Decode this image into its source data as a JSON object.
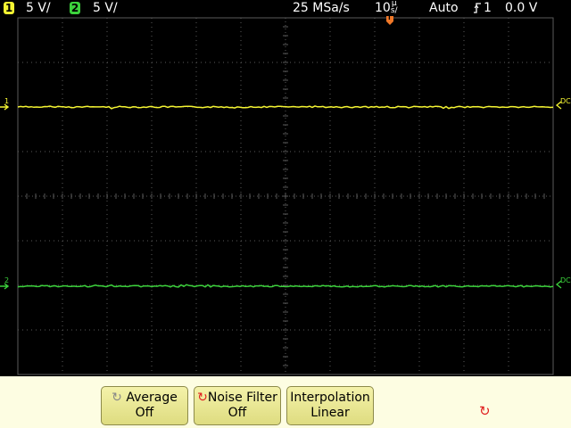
{
  "status": {
    "ch1_number": "1",
    "ch1_scale": "5 V/",
    "ch2_number": "2",
    "ch2_scale": "5 V/",
    "sample_rate": "25 MSa/s",
    "timebase_value": "10",
    "timebase_unit_top": "µ",
    "timebase_unit_bottom": "s/",
    "trigger_mode": "Auto",
    "trigger_slope_icon": "rising-edge-icon",
    "trigger_source": "1",
    "trigger_level": "0.0 V"
  },
  "markers": {
    "trigger_position_label": "T",
    "ch1_ground_label": "1",
    "ch2_ground_label": "2",
    "ch1_coupling": "DC",
    "ch2_coupling": "DC"
  },
  "colors": {
    "ch1": "#f5f532",
    "ch2": "#3cd23c",
    "grid": "#5a5a5a",
    "trigger_marker": "#f07828",
    "softkey_bg": "#f0ee9c",
    "softkey_bar": "#fdfde2",
    "knob_active": "#e02020"
  },
  "softkeys": [
    {
      "line1": "Average",
      "line2": "Off",
      "icon": "knob-icon",
      "icon_color": "#888888"
    },
    {
      "line1": "Noise Filter",
      "line2": "Off",
      "icon": "knob-icon",
      "icon_color": "#e02020"
    },
    {
      "line1": "Interpolation",
      "line2": "Linear",
      "icon": "",
      "icon_color": ""
    }
  ],
  "entry_knob_icon": "knob-icon"
}
